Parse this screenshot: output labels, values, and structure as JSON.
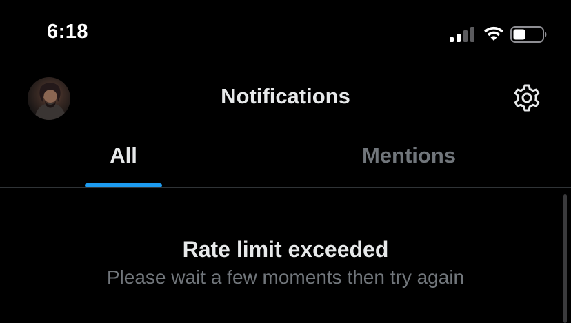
{
  "status_bar": {
    "time": "6:18",
    "signal_icon": "cellular-signal-icon",
    "wifi_icon": "wifi-icon",
    "battery_icon": "battery-icon",
    "battery_level": 0.35
  },
  "header": {
    "title": "Notifications",
    "avatar_icon": "avatar",
    "settings_icon": "gear-icon"
  },
  "tabs": [
    {
      "label": "All",
      "selected": true
    },
    {
      "label": "Mentions",
      "selected": false
    }
  ],
  "message": {
    "title": "Rate limit exceeded",
    "subtitle": "Please wait a few moments then try again"
  },
  "colors": {
    "background": "#000000",
    "text_primary": "#e7e9ea",
    "text_secondary": "#71767b",
    "accent": "#1d9bf0",
    "divider": "#2f3336"
  }
}
